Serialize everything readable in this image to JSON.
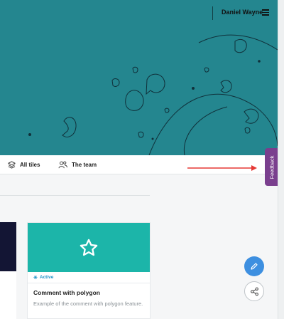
{
  "header": {
    "user_name": "Daniel Wayne",
    "menu_icon": "hamburger-icon",
    "background_color": "#24868f"
  },
  "tabs": [
    {
      "label": "All tiles",
      "icon": "layers-icon"
    },
    {
      "label": "The team",
      "icon": "people-icon"
    }
  ],
  "feedback": {
    "label": "Feedback",
    "color": "#7a3f8e"
  },
  "cards": [
    {
      "title": "Comment with polygon",
      "description": "Example of the comment with polygon feature.",
      "status": "Active",
      "icon": "star-icon",
      "media_color": "#1cb5a9"
    }
  ],
  "fabs": [
    {
      "icon": "pencil-icon",
      "color": "#3d8fe0"
    },
    {
      "icon": "share-icon"
    }
  ],
  "annotation": {
    "arrow_color": "#e53935"
  }
}
